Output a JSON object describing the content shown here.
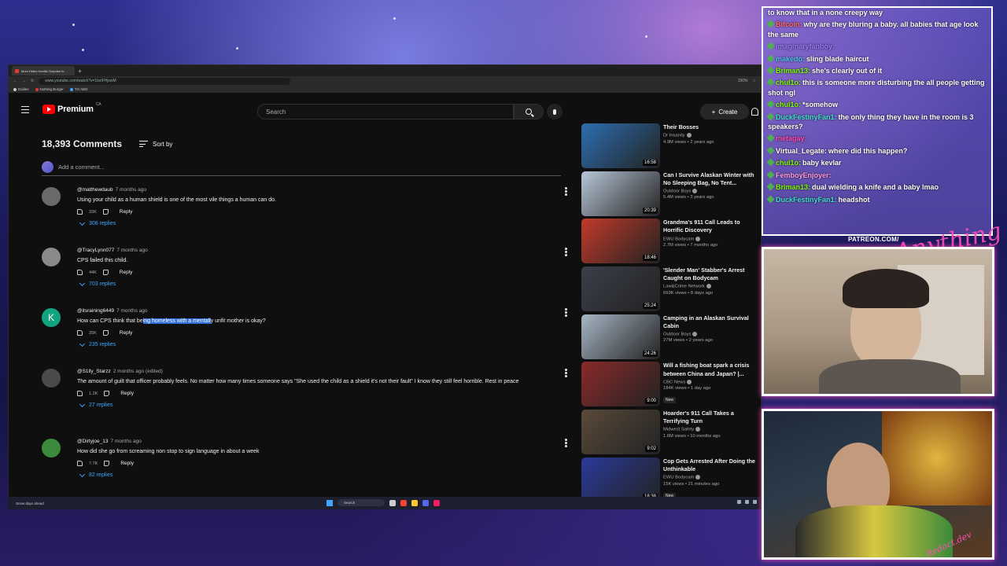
{
  "browser": {
    "tab_title": "Mom Hides Horrific Surprise fo",
    "url": "www.youtube.com/watch?v=1bzlFHjxwM",
    "zoom": "150%",
    "bookmarks": [
      "Dailies",
      "Nothing Burger",
      "TO ADD"
    ]
  },
  "youtube": {
    "logo_text": "Premium",
    "logo_region": "CA",
    "search_placeholder": "Search",
    "create_label": "Create"
  },
  "comments": {
    "count_label": "18,393 Comments",
    "sort_label": "Sort by",
    "add_placeholder": "Add a comment...",
    "items": [
      {
        "avatar_letter": "",
        "avatar_color": "#6a6a6a",
        "author": "@matthewdaub",
        "time": "7 months ago",
        "text": "Using your child as a human shield is one of the most vile things a human can do.",
        "likes": "33K",
        "reply_label": "Reply",
        "replies": "308 replies"
      },
      {
        "avatar_letter": "",
        "avatar_color": "#8a8a8a",
        "author": "@TracyLynn077",
        "time": "7 months ago",
        "text": "CPS failed this child.",
        "likes": "44K",
        "reply_label": "Reply",
        "replies": "703 replies"
      },
      {
        "avatar_letter": "K",
        "avatar_color": "#12a37f",
        "author": "@itsraining6449",
        "time": "7 months ago",
        "text_before": "How can CPS think that be",
        "text_highlight": "ing homeless with a mentall",
        "text_after": "y unfit mother is okay?",
        "likes": "25K",
        "reply_label": "Reply",
        "replies": "235 replies"
      },
      {
        "avatar_letter": "",
        "avatar_color": "#4a4a4a",
        "author": "@S1lly_Starzz",
        "time": "2 months ago (edited)",
        "text": "The amount of guilt that officer probably feels. No matter how many times someone says \"She used the child as a shield it's not their fault\" I know they still feel horrible. Rest in peace",
        "likes": "1.2K",
        "reply_label": "Reply",
        "replies": "27 replies"
      },
      {
        "avatar_letter": "",
        "avatar_color": "#3c8a3c",
        "author": "@Dirtyjoe_13",
        "time": "7 months ago",
        "text": "How did she go from screaming non stop to sign language in about a week",
        "likes": "7.7K",
        "reply_label": "Reply",
        "replies": "82 replies"
      }
    ]
  },
  "sidebar": {
    "videos": [
      {
        "title": "Their Bosses",
        "channel": "Dr Insanity",
        "stats": "4.9M views • 2 years ago",
        "duration": "16:58",
        "thumb": "#2d6fb0",
        "new": false
      },
      {
        "title": "Can I Survive Alaskan Winter with No Sleeping Bag, No Tent...",
        "channel": "Outdoor Boys",
        "stats": "5.4M views • 3 years ago",
        "duration": "20:39",
        "thumb": "#b8c7d8",
        "new": false
      },
      {
        "title": "Grandma's 911 Call Leads to Horrific Discovery",
        "channel": "EWU Bodycam",
        "stats": "2.7M views • 7 months ago",
        "duration": "18:46",
        "thumb": "#c23a2a",
        "new": false
      },
      {
        "title": "'Slender Man' Stabber's Arrest Caught on Bodycam",
        "channel": "Law&Crime Network",
        "stats": "663K views • 8 days ago",
        "duration": "25:24",
        "thumb": "#3b3f4a",
        "new": false
      },
      {
        "title": "Camping in an Alaskan Survival Cabin",
        "channel": "Outdoor Boys",
        "stats": "27M views • 2 years ago",
        "duration": "24:26",
        "thumb": "#a7b6c5",
        "new": false
      },
      {
        "title": "Will a fishing boat spark a crisis between China and Japan? |...",
        "channel": "CBC News",
        "stats": "184K views • 1 day ago",
        "duration": "9:00",
        "thumb": "#8a2a2a",
        "new": true,
        "new_label": "New"
      },
      {
        "title": "Hoarder's 911 Call Takes a Terrifying Turn",
        "channel": "Midwest Safety",
        "stats": "1.6M views • 10 months ago",
        "duration": "9:02",
        "thumb": "#5a4a3a",
        "new": false
      },
      {
        "title": "Cop Gets Arrested After Doing the Unthinkable",
        "channel": "EWU Bodycam",
        "stats": "15K views • 21 minutes ago",
        "duration": "18:38",
        "thumb": "#2a3a9a",
        "new": true,
        "new_label": "New"
      }
    ]
  },
  "chat": {
    "messages": [
      {
        "user": "",
        "user_color": "#ffffff",
        "text": "to know that in a none creepy way"
      },
      {
        "user": "Bitcoin:",
        "user_color": "#ff6b6b",
        "text": "why are they bluring a baby. all babies that age look the same"
      },
      {
        "user": "imaginaryfanboy:",
        "user_color": "#9b7bff",
        "text": ""
      },
      {
        "user": "makedo:",
        "user_color": "#4fc3f7",
        "text": "sling blade haircut"
      },
      {
        "user": "Briman13:",
        "user_color": "#7CFC00",
        "text": "she's clearly out of it"
      },
      {
        "user": "chul1o:",
        "user_color": "#7CFC00",
        "text": "this is someone more disturbing the all people getting shot ngl"
      },
      {
        "user": "chul1o:",
        "user_color": "#7CFC00",
        "text": "*somehow"
      },
      {
        "user": "DuckFestinyFan1:",
        "user_color": "#40e0d0",
        "text": "the only thing they have in the room is 3 speakers?"
      },
      {
        "user": "metagay:",
        "user_color": "#ff4fb8",
        "text": ""
      },
      {
        "user": "Virtual_Legate:",
        "user_color": "#ffffff",
        "text": "where did this happen?"
      },
      {
        "user": "chul1o:",
        "user_color": "#7CFC00",
        "text": "baby kevlar"
      },
      {
        "user": "FemboyEnjoyer:",
        "user_color": "#ff9de0",
        "text": ""
      },
      {
        "user": "Briman13:",
        "user_color": "#7CFC00",
        "text": "dual wielding a knife and a baby lmao"
      },
      {
        "user": "DuckFestinyFan1:",
        "user_color": "#40e0d0",
        "text": "headshot"
      }
    ]
  },
  "branding": {
    "patreon": "PATREON.COM/",
    "script": "Anything Else",
    "redact": "Redact.dev"
  },
  "taskbar": {
    "weather": "Snow days ahead",
    "search": "Search"
  }
}
